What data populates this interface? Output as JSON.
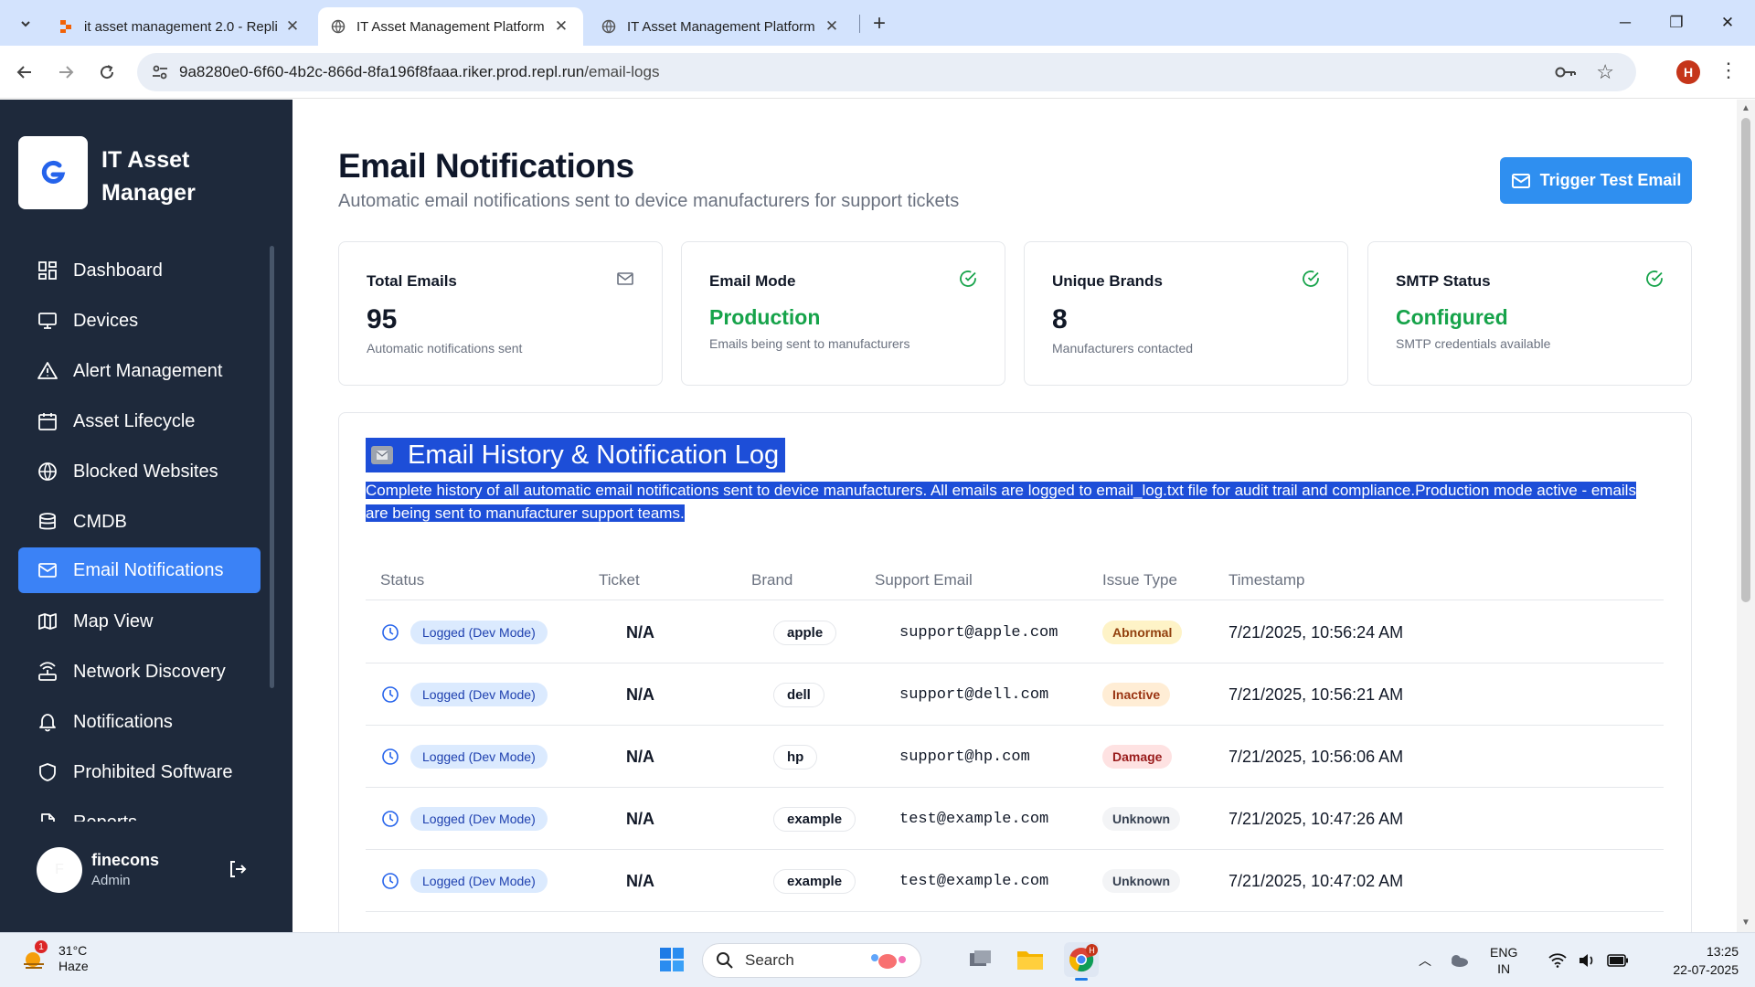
{
  "browser": {
    "tabs": [
      {
        "title": "it asset management 2.0 - Repli"
      },
      {
        "title": "IT Asset Management Platform"
      },
      {
        "title": "IT Asset Management Platform"
      }
    ],
    "url_host": "9a8280e0-6f60-4b2c-866d-8fa196f8faaa.riker.prod.repl.run",
    "url_path": "/email-logs",
    "profile_initial": "H"
  },
  "sidebar": {
    "app_title": "IT Asset Manager",
    "items": [
      {
        "label": "Dashboard",
        "icon": "dashboard-icon"
      },
      {
        "label": "Devices",
        "icon": "monitor-icon"
      },
      {
        "label": "Alert Management",
        "icon": "warning-icon"
      },
      {
        "label": "Asset Lifecycle",
        "icon": "calendar-icon"
      },
      {
        "label": "Blocked Websites",
        "icon": "globe-icon"
      },
      {
        "label": "CMDB",
        "icon": "database-icon"
      },
      {
        "label": "Email Notifications",
        "icon": "mail-icon"
      },
      {
        "label": "Map View",
        "icon": "map-icon"
      },
      {
        "label": "Network Discovery",
        "icon": "network-icon"
      },
      {
        "label": "Notifications",
        "icon": "bell-icon"
      },
      {
        "label": "Prohibited Software",
        "icon": "shield-icon"
      },
      {
        "label": "Reports",
        "icon": "file-icon"
      }
    ],
    "active_item": "Email Notifications",
    "user": {
      "name": "finecons",
      "role": "Admin",
      "initial": "F"
    }
  },
  "main": {
    "title": "Email Notifications",
    "subtitle": "Automatic email notifications sent to device manufacturers for support tickets",
    "trigger_button": "Trigger Test Email",
    "stats": [
      {
        "label": "Total Emails",
        "value": "95",
        "desc": "Automatic notifications sent",
        "icon": "mail-icon"
      },
      {
        "label": "Email Mode",
        "value": "Production",
        "desc": "Emails being sent to manufacturers",
        "icon": "check-circle-icon"
      },
      {
        "label": "Unique Brands",
        "value": "8",
        "desc": "Manufacturers contacted",
        "icon": "check-circle-icon"
      },
      {
        "label": "SMTP Status",
        "value": "Configured",
        "desc": "SMTP credentials available",
        "icon": "check-circle-icon"
      }
    ],
    "log": {
      "title": "Email History & Notification Log",
      "description": "Complete history of all automatic email notifications sent to device manufacturers. All emails are logged to email_log.txt file for audit trail and compliance.Production mode active - emails are being sent to manufacturer support teams.",
      "columns": [
        "Status",
        "Ticket",
        "Brand",
        "Support Email",
        "Issue Type",
        "Timestamp"
      ],
      "rows": [
        {
          "status": "Logged (Dev Mode)",
          "ticket": "N/A",
          "brand": "apple",
          "email": "support@apple.com",
          "issue": "Abnormal",
          "timestamp": "7/21/2025, 10:56:24 AM"
        },
        {
          "status": "Logged (Dev Mode)",
          "ticket": "N/A",
          "brand": "dell",
          "email": "support@dell.com",
          "issue": "Inactive",
          "timestamp": "7/21/2025, 10:56:21 AM"
        },
        {
          "status": "Logged (Dev Mode)",
          "ticket": "N/A",
          "brand": "hp",
          "email": "support@hp.com",
          "issue": "Damage",
          "timestamp": "7/21/2025, 10:56:06 AM"
        },
        {
          "status": "Logged (Dev Mode)",
          "ticket": "N/A",
          "brand": "example",
          "email": "test@example.com",
          "issue": "Unknown",
          "timestamp": "7/21/2025, 10:47:26 AM"
        },
        {
          "status": "Logged (Dev Mode)",
          "ticket": "N/A",
          "brand": "example",
          "email": "test@example.com",
          "issue": "Unknown",
          "timestamp": "7/21/2025, 10:47:02 AM"
        }
      ]
    }
  },
  "taskbar": {
    "weather_temp": "31°C",
    "weather_cond": "Haze",
    "weather_badge": "1",
    "search_placeholder": "Search",
    "lang": "ENG",
    "region": "IN",
    "time": "13:25",
    "date": "22-07-2025"
  },
  "colors": {
    "sidebar_bg": "#1e293b",
    "accent": "#3b82f6",
    "success": "#16a34a",
    "selection": "#1d4ed8"
  }
}
